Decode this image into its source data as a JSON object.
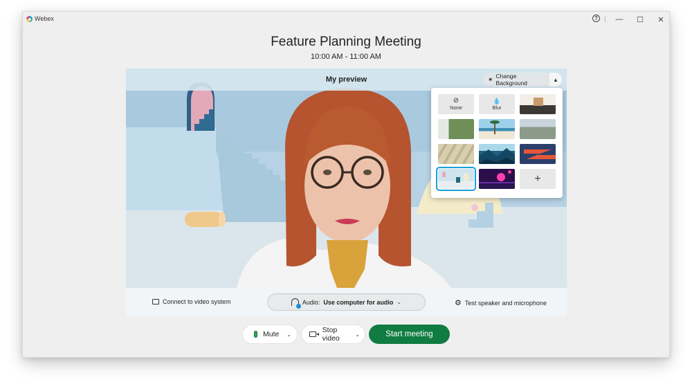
{
  "window": {
    "app_name": "Webex",
    "help_glyph": "?",
    "minimize_glyph": "—",
    "maximize_glyph": "☐",
    "close_glyph": "✕"
  },
  "meeting": {
    "title": "Feature Planning Meeting",
    "time": "10:00 AM - 11:00 AM"
  },
  "preview": {
    "title": "My preview",
    "change_background_label": "Change Background",
    "collapse_glyph": "▲"
  },
  "backgrounds": {
    "selected_index": 9,
    "tiles": [
      {
        "label": "None",
        "glyph": "⊘",
        "kind": "option"
      },
      {
        "label": "Blur",
        "glyph": "💧",
        "kind": "option"
      },
      {
        "label": "Modern living room",
        "kind": "image"
      },
      {
        "label": "Office with plants",
        "kind": "image"
      },
      {
        "label": "Beach with palm tree",
        "kind": "image"
      },
      {
        "label": "Blurred mountains",
        "kind": "image"
      },
      {
        "label": "Sunlit wall shadows",
        "kind": "image"
      },
      {
        "label": "Blue mountains",
        "kind": "image"
      },
      {
        "label": "Red zigzag",
        "kind": "image"
      },
      {
        "label": "Pastel room",
        "kind": "image"
      },
      {
        "label": "Neon synthwave",
        "kind": "image"
      },
      {
        "label": "Add background",
        "glyph": "+",
        "kind": "add"
      }
    ]
  },
  "controls": {
    "connect_label": "Connect to video system",
    "audio_prefix": "Audio:",
    "audio_value": "Use computer for audio",
    "test_label": "Test speaker and microphone"
  },
  "actions": {
    "mute_label": "Mute",
    "stop_video_label": "Stop video",
    "start_label": "Start meeting",
    "chevron_glyph": "⌄"
  },
  "colors": {
    "start_button": "#107c41",
    "selected_outline": "#1aa0d8",
    "mic_icon": "#2bab5e"
  }
}
